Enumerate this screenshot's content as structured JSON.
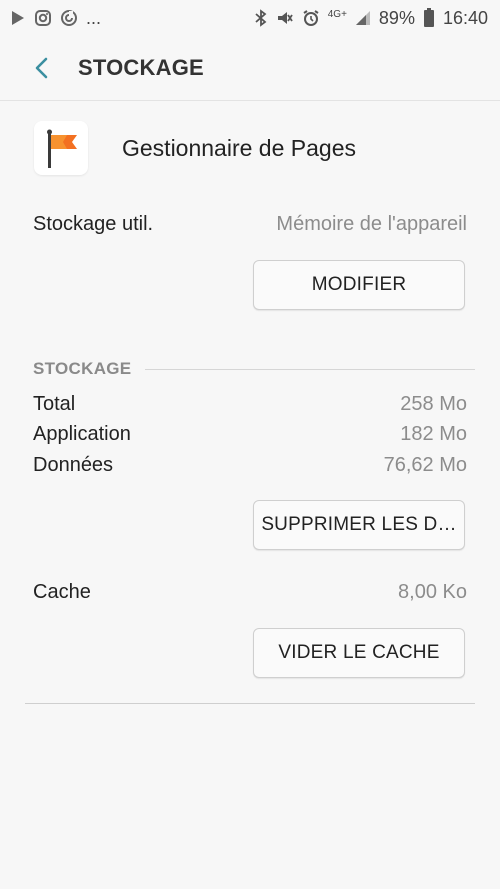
{
  "status_bar": {
    "left_icons": [
      "play-store-icon",
      "instagram-icon",
      "sync-icon"
    ],
    "more": "...",
    "network": "4G+",
    "battery_percent": "89%",
    "time": "16:40"
  },
  "app_bar": {
    "title": "STOCKAGE"
  },
  "app": {
    "name": "Gestionnaire de Pages"
  },
  "storage_used": {
    "label": "Stockage util.",
    "value": "Mémoire de l'appareil",
    "button": "MODIFIER"
  },
  "storage": {
    "section_title": "STOCKAGE",
    "rows": [
      {
        "label": "Total",
        "value": "258 Mo"
      },
      {
        "label": "Application",
        "value": "182 Mo"
      },
      {
        "label": "Données",
        "value": "76,62 Mo"
      }
    ],
    "clear_data_button": "SUPPRIMER LES D…"
  },
  "cache": {
    "label": "Cache",
    "value": "8,00 Ko",
    "button": "VIDER LE CACHE"
  },
  "colors": {
    "accent": "#3b8fa0",
    "brand_orange": "#f37021"
  }
}
